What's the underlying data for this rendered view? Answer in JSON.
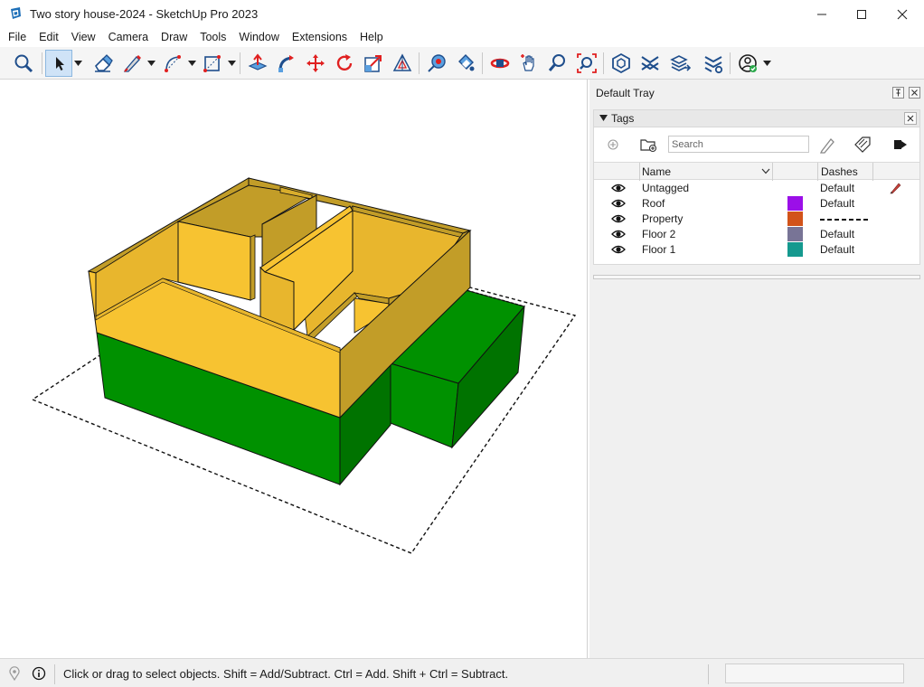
{
  "window": {
    "title": "Two story house-2024 - SketchUp Pro 2023"
  },
  "menu": [
    "File",
    "Edit",
    "View",
    "Camera",
    "Draw",
    "Tools",
    "Window",
    "Extensions",
    "Help"
  ],
  "toolbar": {
    "tools": [
      "search-icon",
      "select-icon",
      "eraser-icon",
      "pencil-icon",
      "arc-icon",
      "rectangle-icon",
      "push-pull-icon",
      "follow-me-icon",
      "move-icon",
      "rotate-icon",
      "scale-icon",
      "offset-icon",
      "tape-measure-icon",
      "paint-bucket-icon",
      "orbit-icon",
      "pan-icon",
      "zoom-icon",
      "zoom-extents-icon",
      "warehouse-icon",
      "extension-icon",
      "layers-send-icon",
      "extension-manager-icon",
      "account-icon"
    ]
  },
  "tray": {
    "title": "Default Tray"
  },
  "tags": {
    "panel_title": "Tags",
    "search_placeholder": "Search",
    "columns": {
      "name": "Name",
      "dashes": "Dashes"
    },
    "rows": [
      {
        "name": "Untagged",
        "color": "",
        "dashes": "Default"
      },
      {
        "name": "Roof",
        "color": "#9b0fe8",
        "dashes": "Default"
      },
      {
        "name": "Property",
        "color": "#d2531a",
        "dashes": ""
      },
      {
        "name": "Floor 2",
        "color": "#787496",
        "dashes": "Default"
      },
      {
        "name": "Floor 1",
        "color": "#15998f",
        "dashes": "Default"
      }
    ]
  },
  "status": {
    "message": "Click or drag to select objects. Shift = Add/Subtract. Ctrl = Add. Shift + Ctrl = Subtract."
  },
  "colors": {
    "floor2": "#f7c331",
    "floor1": "#009100",
    "accent": "#cfe3f7"
  }
}
